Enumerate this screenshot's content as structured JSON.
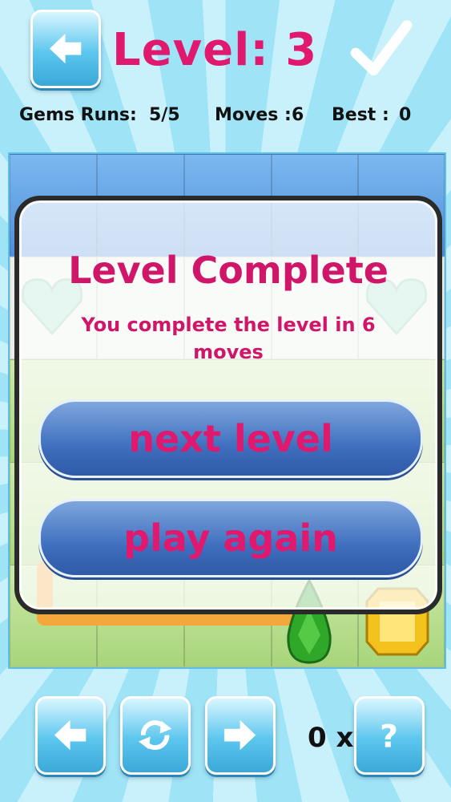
{
  "header": {
    "level_label": "Level: 3"
  },
  "stats": {
    "gems_runs_label": "Gems Runs:",
    "gems_runs_value": "5/5",
    "moves_label": "Moves :",
    "moves_value": "6",
    "best_label": "Best :",
    "best_value": "0"
  },
  "dialog": {
    "title": "Level Complete",
    "message": "You complete the level in 6 moves",
    "next_label": "next level",
    "replay_label": "play again"
  },
  "footer": {
    "hint_count": "0 x"
  },
  "icons": {
    "back": "left-arrow-icon",
    "done": "checkmark-icon",
    "prev": "left-arrow-icon",
    "restart": "refresh-icon",
    "next": "right-arrow-icon",
    "help": "question-mark-icon"
  },
  "colors": {
    "accent": "#e0186e",
    "button": "#5cc6ee",
    "pill": "#3f6fbf",
    "pipe": "#f4a73a"
  }
}
